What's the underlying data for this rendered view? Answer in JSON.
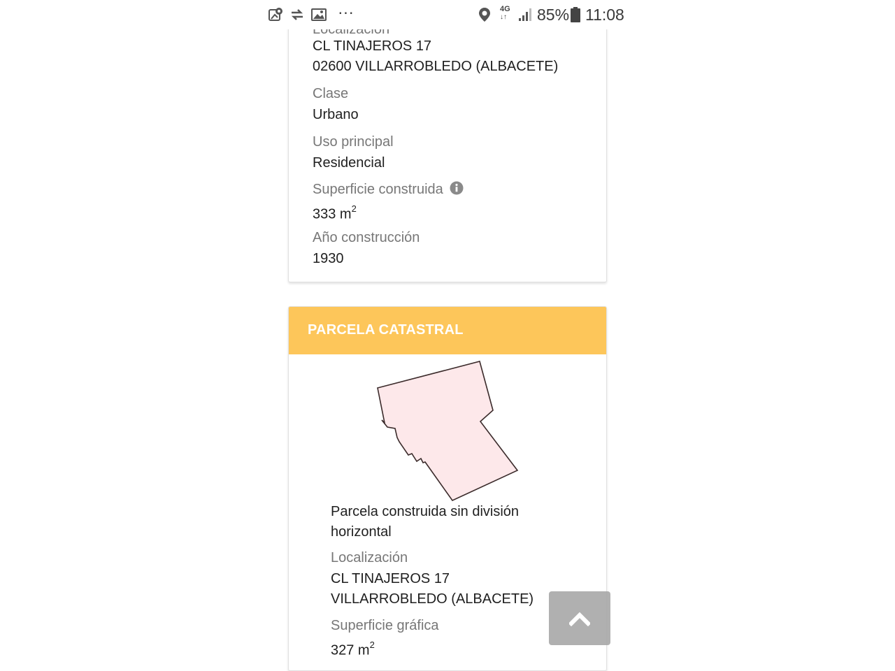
{
  "status_bar": {
    "battery_percent": "85%",
    "time": "11:08",
    "network": "4G",
    "more": "···",
    "icons": [
      "maps-notification-icon",
      "transfer-icon",
      "gallery-icon",
      "location-icon",
      "signal-icon",
      "battery-icon"
    ]
  },
  "building_card": {
    "cut_label": "Localización",
    "address_line1": "CL TINAJEROS 17",
    "address_line2": "02600 VILLARROBLEDO (ALBACETE)",
    "clase_label": "Clase",
    "clase_value": "Urbano",
    "uso_label": "Uso principal",
    "uso_value": "Residencial",
    "superficie_label": "Superficie construida",
    "superficie_value": "333 m",
    "superficie_sup": "2",
    "anio_label": "Año construcción",
    "anio_value": "1930"
  },
  "parcel_card": {
    "header": "PARCELA CATASTRAL",
    "header_color": "#fdc65a",
    "parcel_fill": "#fde8ea",
    "description_line1": "Parcela construida sin división",
    "description_line2": "horizontal",
    "loc_label": "Localización",
    "loc_line1": "CL TINAJEROS 17",
    "loc_line2": "VILLARROBLEDO (ALBACETE)",
    "sup_label": "Superficie gráfica",
    "sup_value": "327 m",
    "sup_sup": "2"
  },
  "scroll_top_button": {
    "icon": "chevron-up-icon"
  }
}
